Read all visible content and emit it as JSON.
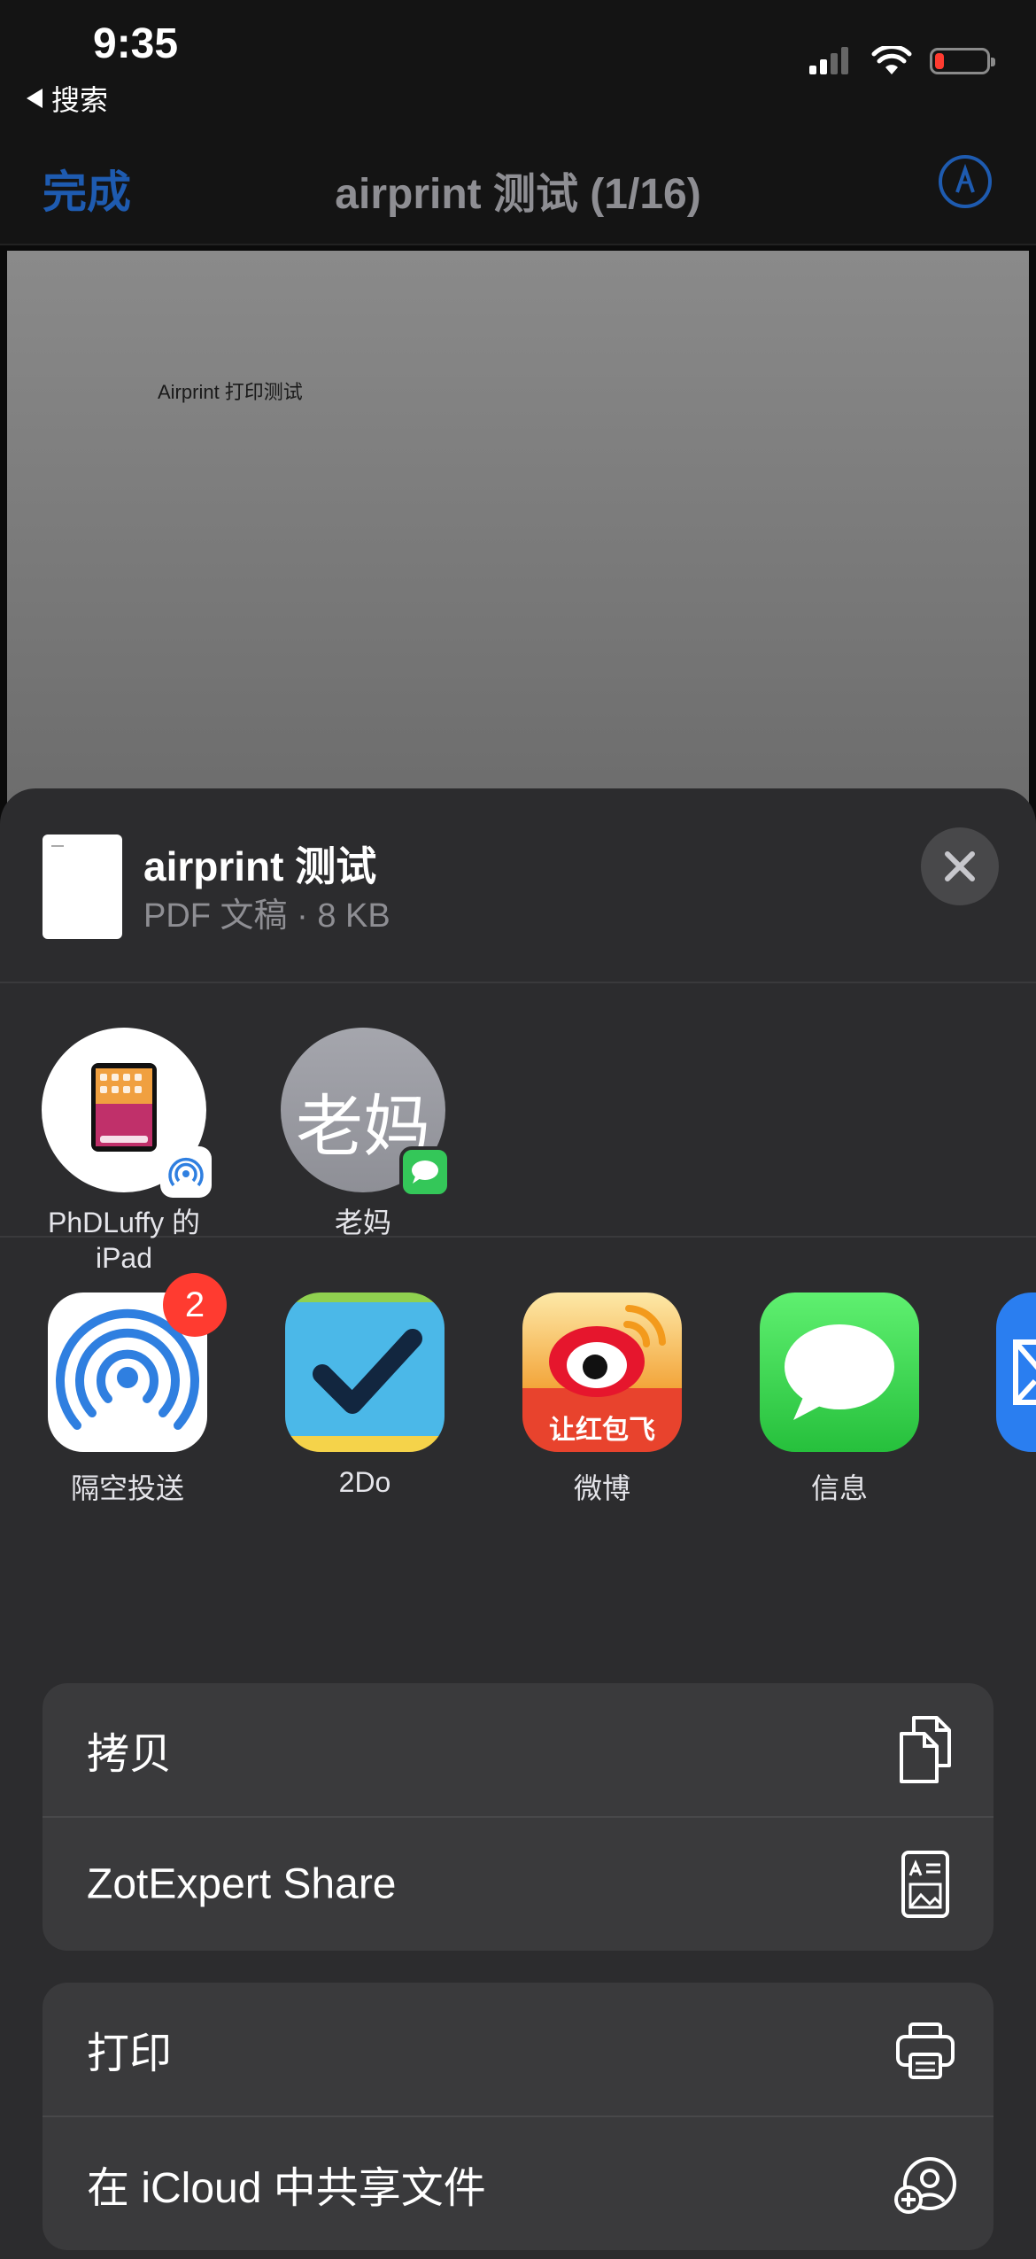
{
  "status_bar": {
    "time": "9:35",
    "back_app": "搜索"
  },
  "nav": {
    "done_label": "完成",
    "title": "airprint 测试 (1/16)"
  },
  "document": {
    "preview_text": "Airprint 打印测试"
  },
  "share_sheet": {
    "file_name": "airprint 测试",
    "file_meta": "PDF 文稿 · 8 KB",
    "people": [
      {
        "name": "PhDLuffy 的\niPad"
      },
      {
        "name": "老妈",
        "avatar_text": "老妈"
      }
    ],
    "apps": [
      {
        "label": "隔空投送",
        "badge": "2"
      },
      {
        "label": "2Do"
      },
      {
        "label": "微博"
      },
      {
        "label": "信息"
      }
    ],
    "weibo_icon_text": "让红包飞",
    "actions_group1": [
      {
        "label": "拷贝",
        "icon": "copy-icon"
      },
      {
        "label": "ZotExpert Share",
        "icon": "zotexpert-icon"
      }
    ],
    "actions_group2": [
      {
        "label": "打印",
        "icon": "printer-icon"
      },
      {
        "label": "在 iCloud 中共享文件",
        "icon": "add-person-icon"
      }
    ]
  },
  "colors": {
    "accent": "#1e5bb0",
    "sheet_bg": "#2c2c2e",
    "row_bg": "#3a3a3c",
    "badge_red": "#ff3b30",
    "messages_green": "#34c759"
  }
}
